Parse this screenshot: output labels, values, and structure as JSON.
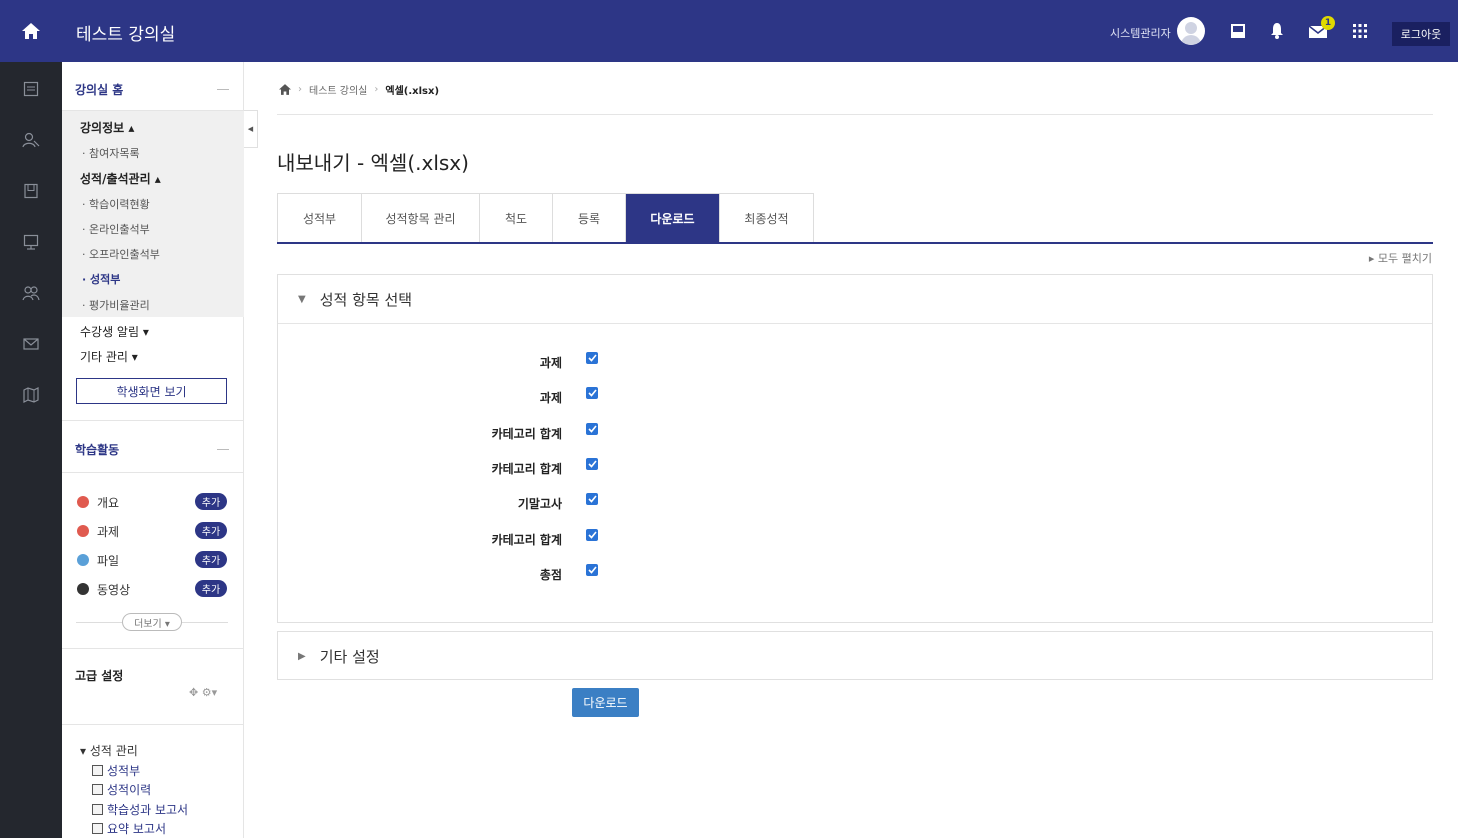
{
  "header": {
    "site_title": "테스트 강의실",
    "username": "시스템관리자",
    "message_count": "1",
    "logout_label": "로그아웃"
  },
  "sidebar": {
    "course_home": "강의실 홈",
    "course_info": {
      "label": "강의정보 ▴",
      "items": [
        "· 참여자목록"
      ]
    },
    "grades": {
      "label": "성적/출석관리 ▴",
      "items": [
        "· 학습이력현황",
        "· 온라인출석부",
        "· 오프라인출석부",
        "· 성적부",
        "· 평가비율관리"
      ]
    },
    "student_notice": "수강생 알림 ▾",
    "other_manage": "기타 관리 ▾",
    "student_view_button": "학생화면 보기",
    "activities": {
      "heading": "학습활동",
      "items": [
        {
          "label": "개요",
          "add": "추가",
          "color": "#e05a4f"
        },
        {
          "label": "과제",
          "add": "추가",
          "color": "#e05a4f"
        },
        {
          "label": "파일",
          "add": "추가",
          "color": "#5aa0d8"
        },
        {
          "label": "동영상",
          "add": "추가",
          "color": "#333333"
        }
      ],
      "more_label": "더보기 ▾"
    },
    "advanced": {
      "heading": "고급 설정",
      "tree_root": "▾ 성적 관리",
      "tree_items": [
        "성적부",
        "성적이력",
        "학습성과 보고서",
        "요약 보고서"
      ]
    }
  },
  "breadcrumb": {
    "course": "테스트 강의실",
    "current": "엑셀(.xlsx)"
  },
  "page_title": "내보내기 - 엑셀(.xlsx)",
  "tabs": [
    {
      "label": "성적부",
      "active": false
    },
    {
      "label": "성적항목 관리",
      "active": false
    },
    {
      "label": "척도",
      "active": false
    },
    {
      "label": "등록",
      "active": false
    },
    {
      "label": "다운로드",
      "active": true
    },
    {
      "label": "최종성적",
      "active": false
    }
  ],
  "expand_all": "▸ 모두 펼치기",
  "grade_items_section": {
    "title": "성적 항목 선택",
    "items": [
      {
        "label": "과제",
        "checked": true
      },
      {
        "label": "과제",
        "checked": true
      },
      {
        "label": "카테고리 합계",
        "checked": true
      },
      {
        "label": "카테고리 합계",
        "checked": true
      },
      {
        "label": "기말고사",
        "checked": true
      },
      {
        "label": "카테고리 합계",
        "checked": true
      },
      {
        "label": "총점",
        "checked": true
      }
    ]
  },
  "other_settings_section": {
    "title": "기타 설정"
  },
  "download_button": "다운로드",
  "colors": {
    "brand": "#2d3686",
    "rail": "#24272e",
    "checkbox": "#2a73d6",
    "download_button": "#3b7fc4"
  }
}
